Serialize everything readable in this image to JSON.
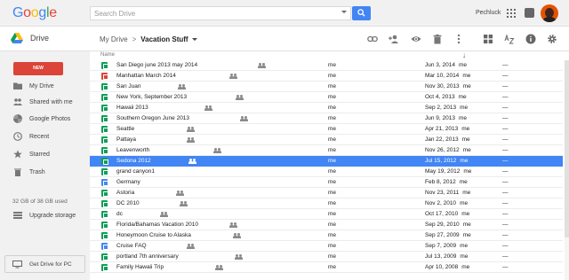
{
  "app": {
    "logo_letters": [
      "G",
      "o",
      "o",
      "g",
      "l",
      "e"
    ],
    "product": "Drive"
  },
  "search": {
    "placeholder": "Search Drive"
  },
  "user": {
    "name": "Pechluck"
  },
  "breadcrumb": {
    "parent": "My Drive",
    "separator": ">",
    "current": "Vacation Stuff"
  },
  "toolbar_icons": [
    "link-icon",
    "add-person-icon",
    "preview-eye-icon",
    "trash-icon",
    "more-vert-icon",
    "grid-view-icon",
    "sort-az-icon",
    "info-icon",
    "settings-gear-icon"
  ],
  "sidebar": {
    "new_label": "NEW",
    "items": [
      {
        "label": "My Drive",
        "icon": "folder-icon"
      },
      {
        "label": "Shared with me",
        "icon": "people-icon"
      },
      {
        "label": "Google Photos",
        "icon": "pinwheel-icon"
      },
      {
        "label": "Recent",
        "icon": "clock-icon"
      },
      {
        "label": "Starred",
        "icon": "star-icon"
      },
      {
        "label": "Trash",
        "icon": "trash-icon"
      }
    ],
    "storage": "32 GB of 38 GB used",
    "upgrade": "Upgrade storage",
    "get_drive": "Get Drive for PC"
  },
  "list": {
    "header_name": "Name",
    "sort_arrow": "↓",
    "rows": [
      {
        "name": "San Diego june 2013 may 2014",
        "shared": true,
        "owner": "me",
        "modified": "Jun 3, 2014",
        "modifier": "me",
        "size": "—",
        "color": "#0f9d58"
      },
      {
        "name": "Manhattan March 2014",
        "shared": true,
        "owner": "me",
        "modified": "Mar 10, 2014",
        "modifier": "me",
        "size": "—",
        "color": "#db4437"
      },
      {
        "name": "San Juan",
        "shared": true,
        "owner": "me",
        "modified": "Nov 30, 2013",
        "modifier": "me",
        "size": "—",
        "color": "#0f9d58"
      },
      {
        "name": "New York, September 2013",
        "shared": true,
        "owner": "me",
        "modified": "Oct 4, 2013",
        "modifier": "me",
        "size": "—",
        "color": "#0f9d58"
      },
      {
        "name": "Hawaii 2013",
        "shared": true,
        "owner": "me",
        "modified": "Sep 2, 2013",
        "modifier": "me",
        "size": "—",
        "color": "#0f9d58"
      },
      {
        "name": "Southern Oregon June 2013",
        "shared": true,
        "owner": "me",
        "modified": "Jun 9, 2013",
        "modifier": "me",
        "size": "—",
        "color": "#0f9d58"
      },
      {
        "name": "Seattle",
        "shared": true,
        "owner": "me",
        "modified": "Apr 21, 2013",
        "modifier": "me",
        "size": "—",
        "color": "#0f9d58"
      },
      {
        "name": "Pattaya",
        "shared": true,
        "owner": "me",
        "modified": "Jan 22, 2013",
        "modifier": "me",
        "size": "—",
        "color": "#0f9d58"
      },
      {
        "name": "Leavenworth",
        "shared": true,
        "owner": "me",
        "modified": "Nov 26, 2012",
        "modifier": "me",
        "size": "—",
        "color": "#0f9d58"
      },
      {
        "name": "Sedona 2012",
        "shared": true,
        "owner": "me",
        "modified": "Jul 15, 2012",
        "modifier": "me",
        "size": "—",
        "color": "#0f9d58",
        "selected": true
      },
      {
        "name": "grand canyon1",
        "shared": false,
        "owner": "me",
        "modified": "May 19, 2012",
        "modifier": "me",
        "size": "—",
        "color": "#0f9d58"
      },
      {
        "name": "Germany",
        "shared": false,
        "owner": "me",
        "modified": "Feb 8, 2012",
        "modifier": "me",
        "size": "—",
        "color": "#4285f4"
      },
      {
        "name": "Astoria",
        "shared": true,
        "owner": "me",
        "modified": "Nov 23, 2011",
        "modifier": "me",
        "size": "—",
        "color": "#0f9d58"
      },
      {
        "name": "DC 2010",
        "shared": true,
        "owner": "me",
        "modified": "Nov 2, 2010",
        "modifier": "me",
        "size": "—",
        "color": "#0f9d58"
      },
      {
        "name": "dc",
        "shared": true,
        "owner": "me",
        "modified": "Oct 17, 2010",
        "modifier": "me",
        "size": "—",
        "color": "#0f9d58"
      },
      {
        "name": "Florida/Bahamas Vacation 2010",
        "shared": true,
        "owner": "me",
        "modified": "Sep 29, 2010",
        "modifier": "me",
        "size": "—",
        "color": "#0f9d58"
      },
      {
        "name": "Honeymoon Cruise to Alaska",
        "shared": true,
        "owner": "me",
        "modified": "Sep 27, 2009",
        "modifier": "me",
        "size": "—",
        "color": "#0f9d58"
      },
      {
        "name": "Cruise FAQ",
        "shared": true,
        "owner": "me",
        "modified": "Sep 7, 2009",
        "modifier": "me",
        "size": "—",
        "color": "#4285f4"
      },
      {
        "name": "portland 7th anniversary",
        "shared": true,
        "owner": "me",
        "modified": "Jul 13, 2009",
        "modifier": "me",
        "size": "—",
        "color": "#0f9d58"
      },
      {
        "name": "Family Hawaii Trip",
        "shared": true,
        "owner": "me",
        "modified": "Apr 10, 2008",
        "modifier": "me",
        "size": "—",
        "color": "#0f9d58"
      }
    ]
  }
}
